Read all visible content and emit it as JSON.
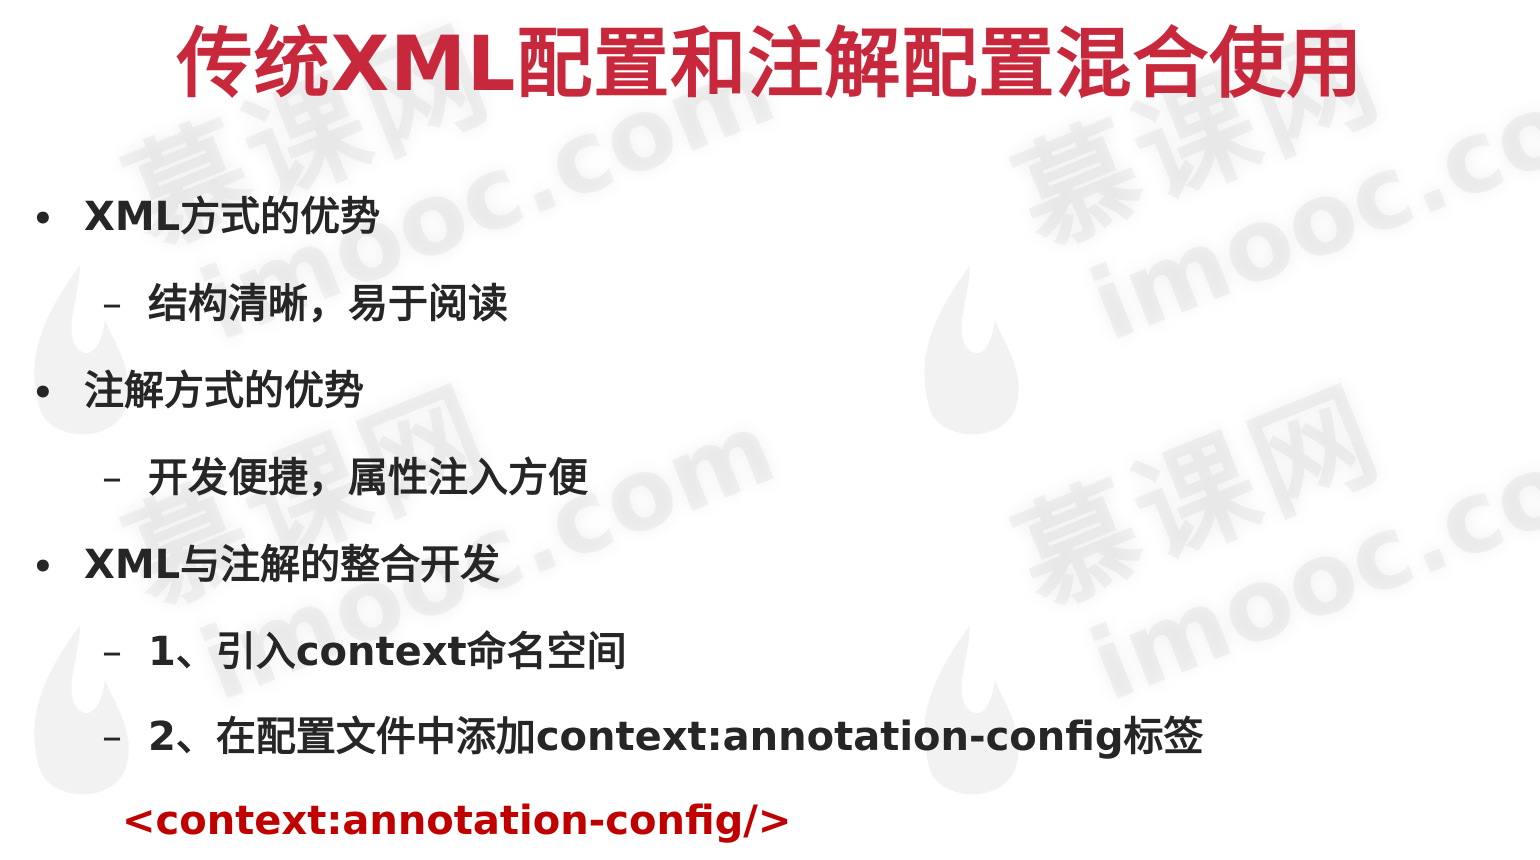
{
  "slide": {
    "title": "传统XML配置和注解配置混合使用",
    "bullets": [
      {
        "marker": "•",
        "text": "XML方式的优势"
      },
      {
        "marker": "–",
        "text": "结构清晰，易于阅读"
      },
      {
        "marker": "•",
        "text": "注解方式的优势"
      },
      {
        "marker": "–",
        "text": "开发便捷，属性注入方便"
      },
      {
        "marker": "•",
        "text": "XML与注解的整合开发"
      },
      {
        "marker": "–",
        "text": "1、引入context命名空间"
      },
      {
        "marker": "–",
        "text": "2、在配置文件中添加context:annotation-config标签"
      }
    ],
    "code_line": "<context:annotation-config/>"
  },
  "watermark": {
    "cn": "慕课网",
    "en": "imooc.com",
    "icon": "flame-logo-icon"
  },
  "colors": {
    "title": "#c8283b",
    "body_text": "#262626",
    "code_text": "#c00000",
    "background": "#ffffff"
  }
}
